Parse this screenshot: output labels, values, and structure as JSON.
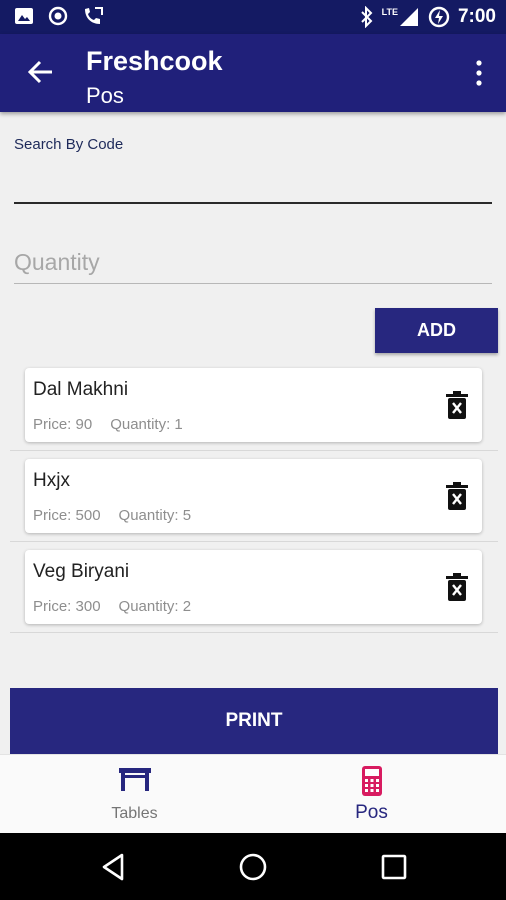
{
  "status_bar": {
    "time": "7:00",
    "network": "LTE"
  },
  "app_bar": {
    "title": "Freshcook",
    "subtitle": "Pos"
  },
  "form": {
    "search_label": "Search By Code",
    "search_value": "",
    "quantity_placeholder": "Quantity",
    "add_label": "ADD"
  },
  "items": [
    {
      "name": "Dal Makhni",
      "price": "Price: 90",
      "quantity": "Quantity: 1"
    },
    {
      "name": "Hxjx",
      "price": "Price: 500",
      "quantity": "Quantity: 5"
    },
    {
      "name": "Veg Biryani",
      "price": "Price: 300",
      "quantity": "Quantity: 2"
    }
  ],
  "print_label": "PRINT",
  "bottom_nav": [
    {
      "label": "Tables",
      "icon": "table-icon",
      "active": false
    },
    {
      "label": "Pos",
      "icon": "pos-terminal-icon",
      "active": true
    }
  ],
  "colors": {
    "primary": "#20207a",
    "status_bar": "#141a63",
    "accent_active_icon": "#d81b60"
  }
}
